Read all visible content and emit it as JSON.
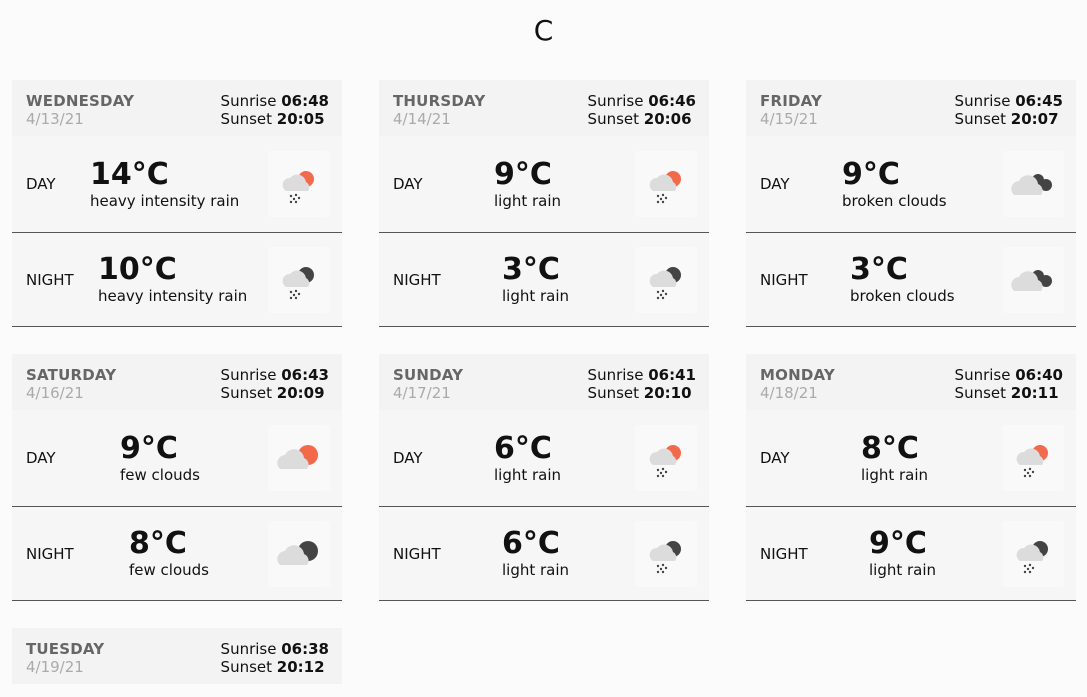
{
  "unit": "C",
  "labels": {
    "day": "DAY",
    "night": "NIGHT",
    "sunrise": "Sunrise",
    "sunset": "Sunset"
  },
  "colors": {
    "sun_orange": "#f26a4b",
    "cloud_gray": "#d8d8d8",
    "moon_dark": "#444444"
  },
  "days": [
    {
      "name": "WEDNESDAY",
      "date": "4/13/21",
      "sunrise": "06:48",
      "sunset": "20:05",
      "day": {
        "temp": "14°C",
        "desc": "heavy intensity rain",
        "icon": "rain-day-icon"
      },
      "night": {
        "temp": "10°C",
        "desc": "heavy intensity rain",
        "icon": "rain-night-icon"
      }
    },
    {
      "name": "THURSDAY",
      "date": "4/14/21",
      "sunrise": "06:46",
      "sunset": "20:06",
      "day": {
        "temp": "9°C",
        "desc": "light rain",
        "icon": "rain-day-icon"
      },
      "night": {
        "temp": "3°C",
        "desc": "light rain",
        "icon": "rain-night-icon"
      }
    },
    {
      "name": "FRIDAY",
      "date": "4/15/21",
      "sunrise": "06:45",
      "sunset": "20:07",
      "day": {
        "temp": "9°C",
        "desc": "broken clouds",
        "icon": "broken-clouds-icon"
      },
      "night": {
        "temp": "3°C",
        "desc": "broken clouds",
        "icon": "broken-clouds-icon"
      }
    },
    {
      "name": "SATURDAY",
      "date": "4/16/21",
      "sunrise": "06:43",
      "sunset": "20:09",
      "day": {
        "temp": "9°C",
        "desc": "few clouds",
        "icon": "few-clouds-day-icon"
      },
      "night": {
        "temp": "8°C",
        "desc": "few clouds",
        "icon": "few-clouds-night-icon"
      }
    },
    {
      "name": "SUNDAY",
      "date": "4/17/21",
      "sunrise": "06:41",
      "sunset": "20:10",
      "day": {
        "temp": "6°C",
        "desc": "light rain",
        "icon": "rain-day-icon"
      },
      "night": {
        "temp": "6°C",
        "desc": "light rain",
        "icon": "rain-night-icon"
      }
    },
    {
      "name": "MONDAY",
      "date": "4/18/21",
      "sunrise": "06:40",
      "sunset": "20:11",
      "day": {
        "temp": "8°C",
        "desc": "light rain",
        "icon": "rain-day-icon"
      },
      "night": {
        "temp": "9°C",
        "desc": "light rain",
        "icon": "rain-night-icon"
      }
    },
    {
      "name": "TUESDAY",
      "date": "4/19/21",
      "sunrise": "06:38",
      "sunset": "20:12"
    }
  ]
}
